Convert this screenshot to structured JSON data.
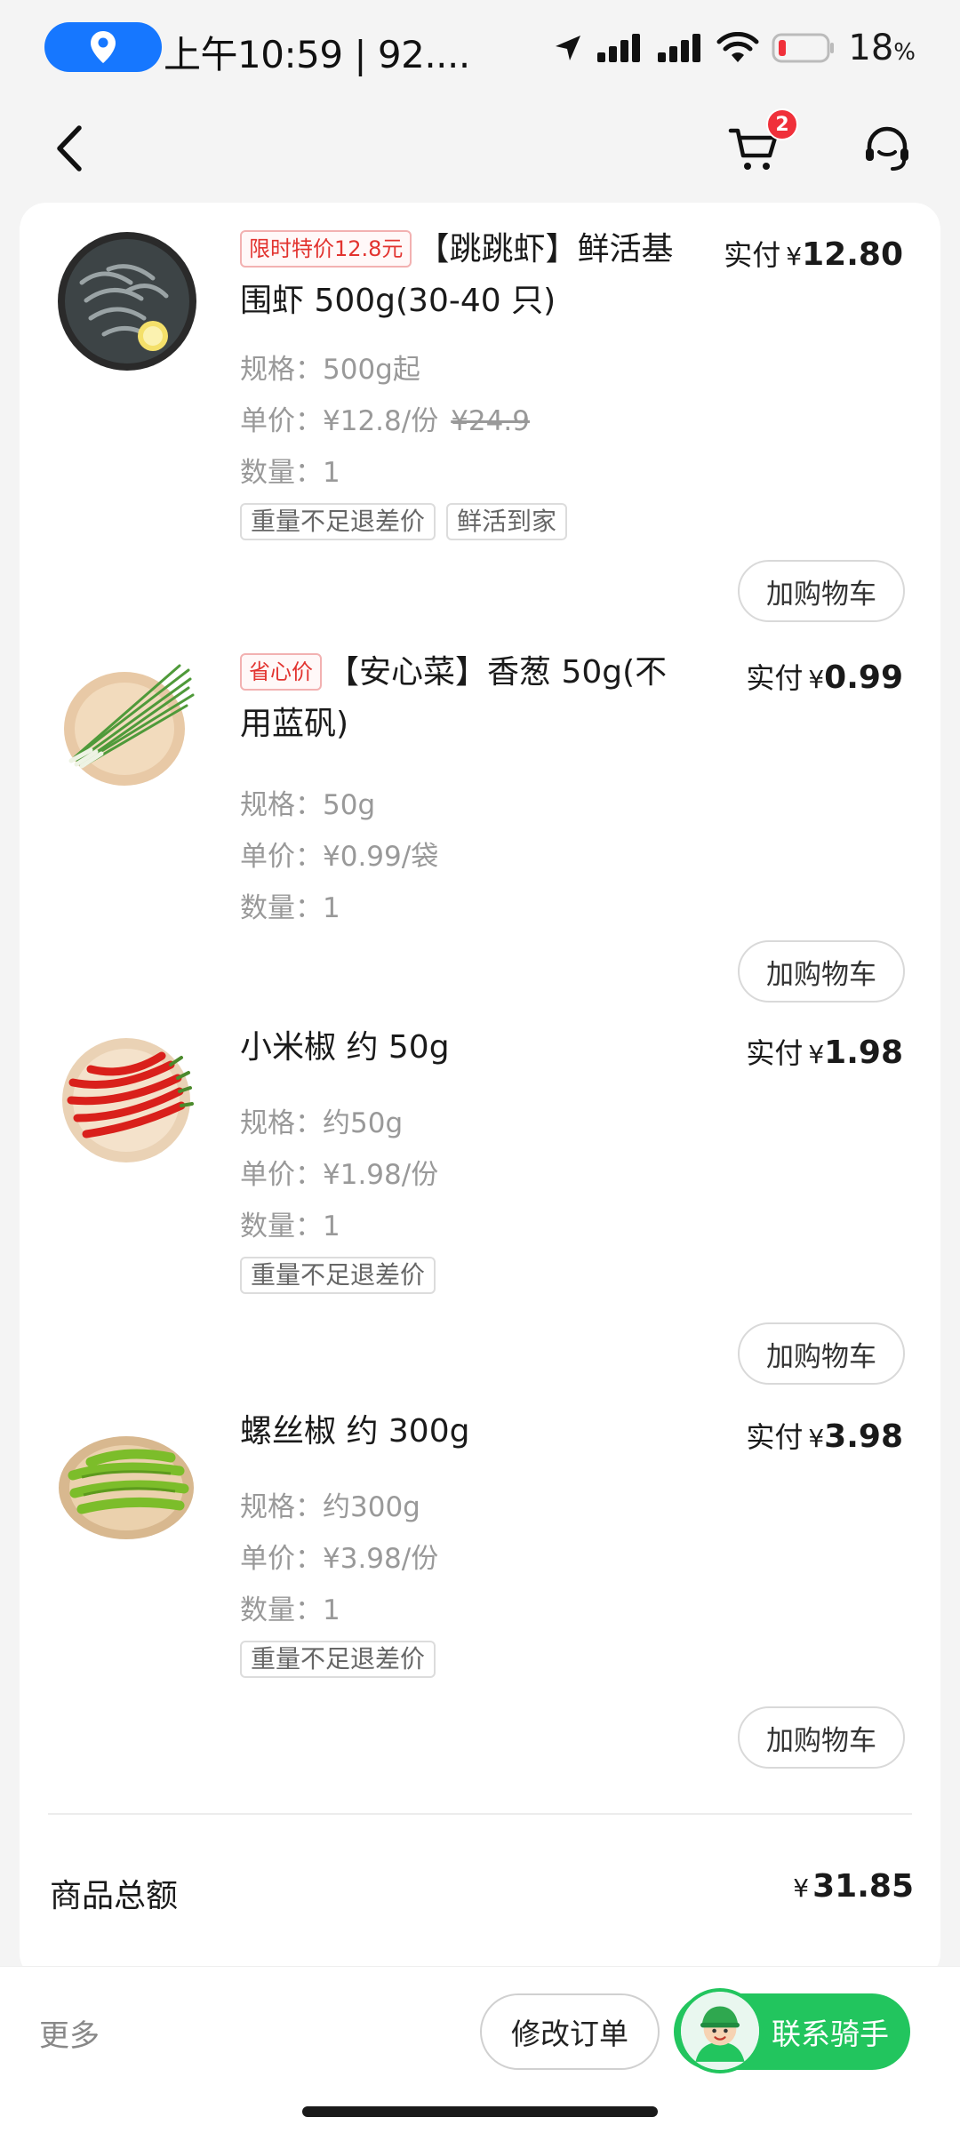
{
  "status_bar": {
    "time": "上午10:59 | 92....",
    "battery_percent": "18",
    "battery_unit": "%"
  },
  "header": {
    "cart_badge": "2"
  },
  "items": [
    {
      "promo_tag": "限时特价12.8元",
      "name": "【跳跳虾】鲜活基围虾 500g(30-40 只)",
      "paid_label": "实付",
      "currency": "¥",
      "paid_amount": "12.80",
      "spec": "规格：500g起",
      "unit_price": "单价：¥12.8/份",
      "original_price": "¥24.9",
      "quantity": "数量：1",
      "tags": [
        "重量不足退差价",
        "鲜活到家"
      ],
      "add_cart_label": "加购物车",
      "image": "shrimp-plate"
    },
    {
      "promo_tag": "省心价",
      "name": "【安心菜】香葱 50g(不用蓝矾)",
      "paid_label": "实付",
      "currency": "¥",
      "paid_amount": "0.99",
      "spec": "规格：50g",
      "unit_price": "单价：¥0.99/袋",
      "quantity": "数量：1",
      "tags": [],
      "add_cart_label": "加购物车",
      "image": "scallion-plate"
    },
    {
      "name": "小米椒 约 50g",
      "paid_label": "实付",
      "currency": "¥",
      "paid_amount": "1.98",
      "spec": "规格：约50g",
      "unit_price": "单价：¥1.98/份",
      "quantity": "数量：1",
      "tags": [
        "重量不足退差价"
      ],
      "add_cart_label": "加购物车",
      "image": "red-chili-plate"
    },
    {
      "name": "螺丝椒 约 300g",
      "paid_label": "实付",
      "currency": "¥",
      "paid_amount": "3.98",
      "spec": "规格：约300g",
      "unit_price": "单价：¥3.98/份",
      "quantity": "数量：1",
      "tags": [
        "重量不足退差价"
      ],
      "add_cart_label": "加购物车",
      "image": "green-pepper-plate"
    }
  ],
  "summary": {
    "total_label": "商品总额",
    "currency": "¥",
    "total_value": "31.85"
  },
  "bottom_bar": {
    "more_label": "更多",
    "modify_label": "修改订单",
    "rider_label": "联系骑手"
  },
  "colors": {
    "accent_green": "#22c55e",
    "promo_red": "#e2332f",
    "badge_red": "#f0303a",
    "location_blue": "#1677ff"
  }
}
